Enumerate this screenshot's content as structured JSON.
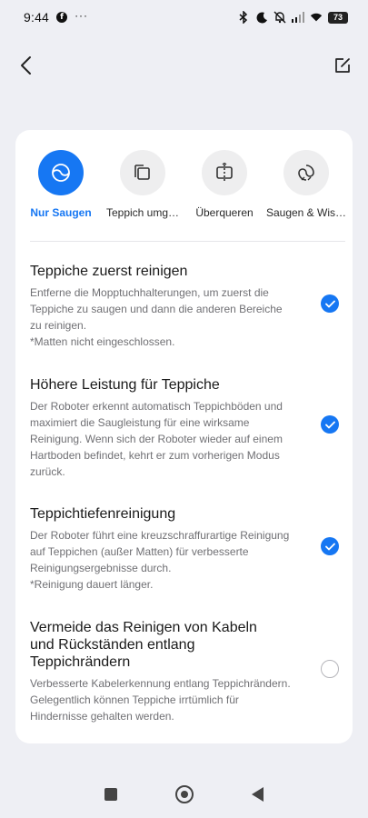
{
  "status_bar": {
    "time": "9:44",
    "battery": "73",
    "dots": "···"
  },
  "accent_color": "#1677f3",
  "modes": [
    {
      "label": "Nur Saugen",
      "icon": "vacuum-swirl-icon",
      "active": true
    },
    {
      "label": "Teppich umg…",
      "icon": "carpet-avoid-icon",
      "active": false
    },
    {
      "label": "Überqueren",
      "icon": "cross-over-icon",
      "active": false
    },
    {
      "label": "Saugen & Wis…",
      "icon": "vacuum-mop-icon",
      "active": false
    }
  ],
  "options": [
    {
      "title": "Teppiche zuerst reinigen",
      "description": "Entferne die Mopptuchhalterungen, um zuerst die Teppiche zu saugen und dann die anderen Bereiche zu reinigen.\n*Matten nicht eingeschlossen.",
      "checked": true
    },
    {
      "title": "Höhere Leistung für Teppiche",
      "description": "Der Roboter erkennt automatisch Teppichböden und maximiert die Saugleistung für eine wirksame Reinigung. Wenn sich der Roboter wieder auf einem Hartboden befindet, kehrt er zum vorherigen Modus zurück.",
      "checked": true
    },
    {
      "title": "Teppichtiefenreinigung",
      "description": "Der Roboter führt eine kreuzschraffurartige Reinigung auf Teppichen (außer Matten) für verbesserte Reinigungsergebnisse durch.\n*Reinigung dauert länger.",
      "checked": true
    },
    {
      "title": "Vermeide das Reinigen von Kabeln und Rückständen entlang Teppichrändern",
      "description": "Verbesserte Kabelerkennung entlang Teppichrändern. Gelegentlich können Teppiche irrtümlich für Hindernisse gehalten werden.",
      "checked": false
    }
  ]
}
